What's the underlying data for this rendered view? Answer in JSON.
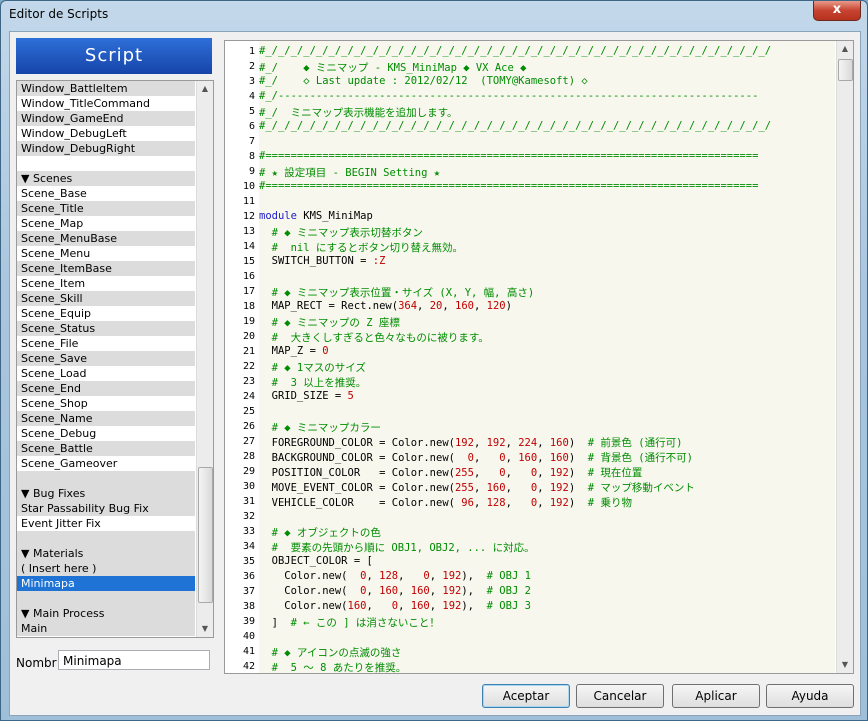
{
  "window": {
    "title": "Editor de Scripts",
    "close_glyph": "x"
  },
  "banner": {
    "label": "Script"
  },
  "script_list": [
    {
      "label": "Window_BattleItem",
      "kind": "item"
    },
    {
      "label": "Window_TitleCommand",
      "kind": "item"
    },
    {
      "label": "Window_GameEnd",
      "kind": "item"
    },
    {
      "label": "Window_DebugLeft",
      "kind": "item"
    },
    {
      "label": "Window_DebugRight",
      "kind": "item"
    },
    {
      "label": "",
      "kind": "blank"
    },
    {
      "label": "▼ Scenes",
      "kind": "section"
    },
    {
      "label": "Scene_Base",
      "kind": "item"
    },
    {
      "label": "Scene_Title",
      "kind": "item"
    },
    {
      "label": "Scene_Map",
      "kind": "item"
    },
    {
      "label": "Scene_MenuBase",
      "kind": "item"
    },
    {
      "label": "Scene_Menu",
      "kind": "item"
    },
    {
      "label": "Scene_ItemBase",
      "kind": "item"
    },
    {
      "label": "Scene_Item",
      "kind": "item"
    },
    {
      "label": "Scene_Skill",
      "kind": "item"
    },
    {
      "label": "Scene_Equip",
      "kind": "item"
    },
    {
      "label": "Scene_Status",
      "kind": "item"
    },
    {
      "label": "Scene_File",
      "kind": "item"
    },
    {
      "label": "Scene_Save",
      "kind": "item"
    },
    {
      "label": "Scene_Load",
      "kind": "item"
    },
    {
      "label": "Scene_End",
      "kind": "item"
    },
    {
      "label": "Scene_Shop",
      "kind": "item"
    },
    {
      "label": "Scene_Name",
      "kind": "item"
    },
    {
      "label": "Scene_Debug",
      "kind": "item"
    },
    {
      "label": "Scene_Battle",
      "kind": "item"
    },
    {
      "label": "Scene_Gameover",
      "kind": "item"
    },
    {
      "label": "",
      "kind": "blank"
    },
    {
      "label": "▼ Bug Fixes",
      "kind": "section"
    },
    {
      "label": "Star Passability Bug Fix",
      "kind": "item"
    },
    {
      "label": "Event Jitter Fix",
      "kind": "item"
    },
    {
      "label": "",
      "kind": "blank"
    },
    {
      "label": "▼ Materials",
      "kind": "section"
    },
    {
      "label": "( Insert here )",
      "kind": "item"
    },
    {
      "label": "Minimapa",
      "kind": "item",
      "selected": true
    },
    {
      "label": "",
      "kind": "blank"
    },
    {
      "label": "▼ Main Process",
      "kind": "section"
    },
    {
      "label": "Main",
      "kind": "item"
    }
  ],
  "name_field": {
    "label": "Nombr",
    "value": "Minimapa"
  },
  "code_lines": [
    [
      [
        "#_/_/_/_/_/_/_/_/_/_/_/_/_/_/_/_/_/_/_/_/_/_/_/_/_/_/_/_/_/_/_/_/_/_/_/_/_/_/_/_/",
        "c"
      ]
    ],
    [
      [
        "#_/    ◆ ミニマップ - KMS_MiniMap ◆ VX Ace ◆",
        "c"
      ]
    ],
    [
      [
        "#_/    ◇ Last update : 2012/02/12  (TOMY@Kamesoft) ◇",
        "c"
      ]
    ],
    [
      [
        "#_/----------------------------------------------------------------------------",
        "c"
      ]
    ],
    [
      [
        "#_/  ミニマップ表示機能を追加します。",
        "c"
      ]
    ],
    [
      [
        "#_/_/_/_/_/_/_/_/_/_/_/_/_/_/_/_/_/_/_/_/_/_/_/_/_/_/_/_/_/_/_/_/_/_/_/_/_/_/_/_/",
        "c"
      ]
    ],
    [],
    [
      [
        "#==============================================================================",
        "c"
      ]
    ],
    [
      [
        "# ★ 設定項目 - BEGIN Setting ★",
        "c"
      ]
    ],
    [
      [
        "#==============================================================================",
        "c"
      ]
    ],
    [],
    [
      [
        "module ",
        "k"
      ],
      [
        "KMS_MiniMap",
        ""
      ]
    ],
    [
      [
        "  # ◆ ミニマップ表示切替ボタン",
        "c"
      ]
    ],
    [
      [
        "  #  nil にするとボタン切り替え無効。",
        "c"
      ]
    ],
    [
      [
        "  SWITCH_BUTTON = ",
        ""
      ],
      [
        ":Z",
        "sym"
      ]
    ],
    [],
    [
      [
        "  # ◆ ミニマップ表示位置・サイズ (X, Y, 幅, 高さ)",
        "c"
      ]
    ],
    [
      [
        "  MAP_RECT = Rect.new(",
        ""
      ],
      [
        "364",
        "n"
      ],
      [
        ", ",
        ""
      ],
      [
        "20",
        "n"
      ],
      [
        ", ",
        ""
      ],
      [
        "160",
        "n"
      ],
      [
        ", ",
        ""
      ],
      [
        "120",
        "n"
      ],
      [
        ")",
        ""
      ]
    ],
    [
      [
        "  # ◆ ミニマップの Z 座標",
        "c"
      ]
    ],
    [
      [
        "  #  大きくしすぎると色々なものに被ります。",
        "c"
      ]
    ],
    [
      [
        "  MAP_Z = ",
        ""
      ],
      [
        "0",
        "n"
      ]
    ],
    [
      [
        "  # ◆ 1マスのサイズ",
        "c"
      ]
    ],
    [
      [
        "  #  3 以上を推奨。",
        "c"
      ]
    ],
    [
      [
        "  GRID_SIZE = ",
        ""
      ],
      [
        "5",
        "n"
      ]
    ],
    [],
    [
      [
        "  # ◆ ミニマップカラー",
        "c"
      ]
    ],
    [
      [
        "  FOREGROUND_COLOR = Color.new(",
        ""
      ],
      [
        "192",
        "n"
      ],
      [
        ", ",
        ""
      ],
      [
        "192",
        "n"
      ],
      [
        ", ",
        ""
      ],
      [
        "224",
        "n"
      ],
      [
        ", ",
        ""
      ],
      [
        "160",
        "n"
      ],
      [
        ")  ",
        ""
      ],
      [
        "# 前景色 (通行可)",
        "c"
      ]
    ],
    [
      [
        "  BACKGROUND_COLOR = Color.new(  ",
        ""
      ],
      [
        "0",
        "n"
      ],
      [
        ",   ",
        ""
      ],
      [
        "0",
        "n"
      ],
      [
        ", ",
        ""
      ],
      [
        "160",
        "n"
      ],
      [
        ", ",
        ""
      ],
      [
        "160",
        "n"
      ],
      [
        ")  ",
        ""
      ],
      [
        "# 背景色 (通行不可)",
        "c"
      ]
    ],
    [
      [
        "  POSITION_COLOR   = Color.new(",
        ""
      ],
      [
        "255",
        "n"
      ],
      [
        ",   ",
        ""
      ],
      [
        "0",
        "n"
      ],
      [
        ",   ",
        ""
      ],
      [
        "0",
        "n"
      ],
      [
        ", ",
        ""
      ],
      [
        "192",
        "n"
      ],
      [
        ")  ",
        ""
      ],
      [
        "# 現在位置",
        "c"
      ]
    ],
    [
      [
        "  MOVE_EVENT_COLOR = Color.new(",
        ""
      ],
      [
        "255",
        "n"
      ],
      [
        ", ",
        ""
      ],
      [
        "160",
        "n"
      ],
      [
        ",   ",
        ""
      ],
      [
        "0",
        "n"
      ],
      [
        ", ",
        ""
      ],
      [
        "192",
        "n"
      ],
      [
        ")  ",
        ""
      ],
      [
        "# マップ移動イベント",
        "c"
      ]
    ],
    [
      [
        "  VEHICLE_COLOR    = Color.new( ",
        ""
      ],
      [
        "96",
        "n"
      ],
      [
        ", ",
        ""
      ],
      [
        "128",
        "n"
      ],
      [
        ",   ",
        ""
      ],
      [
        "0",
        "n"
      ],
      [
        ", ",
        ""
      ],
      [
        "192",
        "n"
      ],
      [
        ")  ",
        ""
      ],
      [
        "# 乗り物",
        "c"
      ]
    ],
    [],
    [
      [
        "  # ◆ オブジェクトの色",
        "c"
      ]
    ],
    [
      [
        "  #  要素の先頭から順に OBJ1, OBJ2, ... に対応。",
        "c"
      ]
    ],
    [
      [
        "  OBJECT_COLOR = [",
        ""
      ]
    ],
    [
      [
        "    Color.new(  ",
        ""
      ],
      [
        "0",
        "n"
      ],
      [
        ", ",
        ""
      ],
      [
        "128",
        "n"
      ],
      [
        ",   ",
        ""
      ],
      [
        "0",
        "n"
      ],
      [
        ", ",
        ""
      ],
      [
        "192",
        "n"
      ],
      [
        "),  ",
        ""
      ],
      [
        "# OBJ 1",
        "c"
      ]
    ],
    [
      [
        "    Color.new(  ",
        ""
      ],
      [
        "0",
        "n"
      ],
      [
        ", ",
        ""
      ],
      [
        "160",
        "n"
      ],
      [
        ", ",
        ""
      ],
      [
        "160",
        "n"
      ],
      [
        ", ",
        ""
      ],
      [
        "192",
        "n"
      ],
      [
        "),  ",
        ""
      ],
      [
        "# OBJ 2",
        "c"
      ]
    ],
    [
      [
        "    Color.new(",
        ""
      ],
      [
        "160",
        "n"
      ],
      [
        ",   ",
        ""
      ],
      [
        "0",
        "n"
      ],
      [
        ", ",
        ""
      ],
      [
        "160",
        "n"
      ],
      [
        ", ",
        ""
      ],
      [
        "192",
        "n"
      ],
      [
        "),  ",
        ""
      ],
      [
        "# OBJ 3",
        "c"
      ]
    ],
    [
      [
        "  ]  ",
        ""
      ],
      [
        "# ← この ] は消さないこと！",
        "c"
      ]
    ],
    [],
    [
      [
        "  # ◆ アイコンの点滅の強さ",
        "c"
      ]
    ],
    [
      [
        "  #  5 ～ 8 あたりを推奨。",
        "c"
      ]
    ]
  ],
  "buttons": {
    "accept": "Aceptar",
    "cancel": "Cancelar",
    "apply": "Aplicar",
    "help": "Ayuda"
  },
  "colors": {
    "selection": "#1e73d4",
    "comment": "#008c00",
    "keyword": "#2020c8",
    "number": "#c00000"
  },
  "icons": {
    "close": "close-icon",
    "scroll_up": "scroll-up-arrow-icon",
    "scroll_down": "scroll-down-arrow-icon"
  }
}
